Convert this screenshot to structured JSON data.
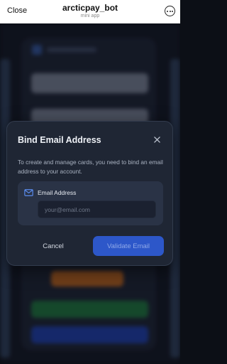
{
  "topbar": {
    "close_label": "Close",
    "title": "arcticpay_bot",
    "subtitle": "mini app"
  },
  "modal": {
    "title": "Bind Email Address",
    "description": "To create and manage cards, you need to bind an email address to your account.",
    "field": {
      "label": "Email Address",
      "value": "",
      "placeholder": "your@email.com"
    },
    "cancel_label": "Cancel",
    "validate_label": "Validate Email"
  },
  "icons": {
    "more": "more-horizontal-icon",
    "close": "close-icon",
    "mail": "mail-icon"
  },
  "colors": {
    "modal_bg": "#1f2634",
    "primary_button": "#2d57c9",
    "accent_icon": "#5b8def"
  }
}
